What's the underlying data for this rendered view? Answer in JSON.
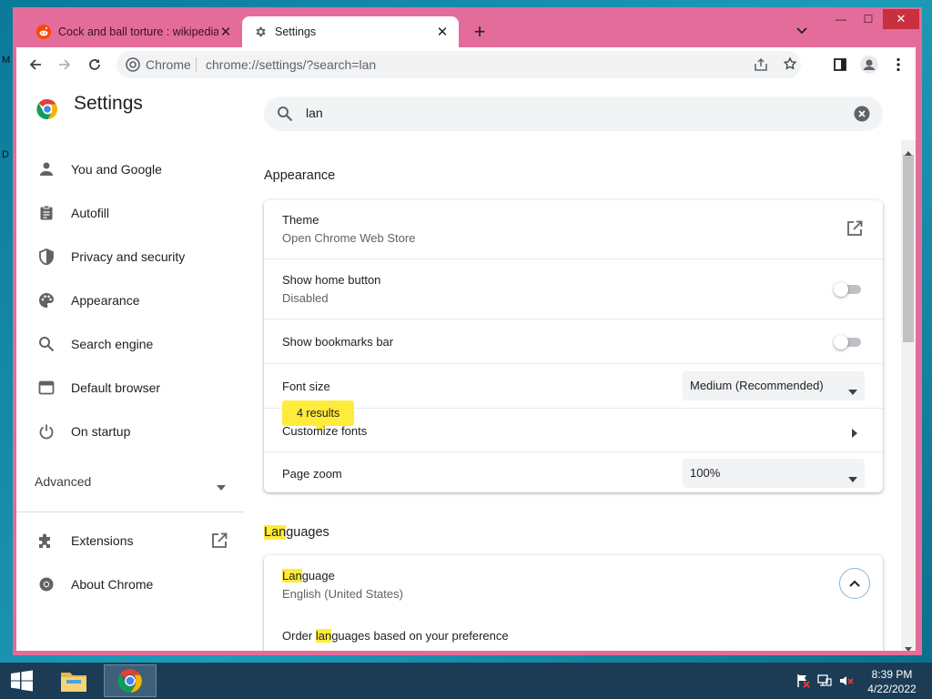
{
  "desktop": {
    "label_1": "M",
    "label_2": "D"
  },
  "tabs": [
    {
      "title": "Cock and ball torture : wikipedia",
      "icon": "reddit-icon",
      "active": false
    },
    {
      "title": "Settings",
      "icon": "gear-icon",
      "active": true
    }
  ],
  "newtab_label": "+",
  "window_controls": {
    "minimize": "—",
    "maximize": "☐",
    "close": "✕"
  },
  "toolbar": {
    "site_label": "Chrome",
    "url": "chrome://settings/?search=lan"
  },
  "sidebar": {
    "title": "Settings",
    "items": [
      {
        "label": "You and Google",
        "icon": "person-icon"
      },
      {
        "label": "Autofill",
        "icon": "clipboard-icon"
      },
      {
        "label": "Privacy and security",
        "icon": "shield-icon"
      },
      {
        "label": "Appearance",
        "icon": "palette-icon"
      },
      {
        "label": "Search engine",
        "icon": "search-icon"
      },
      {
        "label": "Default browser",
        "icon": "browser-icon"
      },
      {
        "label": "On startup",
        "icon": "power-icon"
      }
    ],
    "advanced_label": "Advanced",
    "extensions_label": "Extensions",
    "about_label": "About Chrome"
  },
  "search": {
    "value": "lan"
  },
  "appearance": {
    "title": "Appearance",
    "theme": {
      "title": "Theme",
      "sub": "Open Chrome Web Store"
    },
    "home_button": {
      "title": "Show home button",
      "sub": "Disabled"
    },
    "bookmarks_bar": {
      "title": "Show bookmarks bar"
    },
    "font_size": {
      "title": "Font size",
      "value": "Medium (Recommended)"
    },
    "results_bubble": "4 results",
    "customize_fonts": {
      "title": "Customize fonts"
    },
    "page_zoom": {
      "title": "Page zoom",
      "value": "100%"
    }
  },
  "languages": {
    "title_hl": "Lan",
    "title_rest": "guages",
    "language": {
      "title_hl": "Lan",
      "title_rest": "guage",
      "sub": "English (United States)"
    },
    "order": {
      "pre": "Order ",
      "hl": "lan",
      "post": "guages based on your preference"
    }
  },
  "clock": {
    "time": "8:39 PM",
    "date": "4/22/2022"
  },
  "colors": {
    "window_frame": "#e46c9a",
    "highlight": "#ffeb3b",
    "taskbar": "#1c3c55"
  }
}
